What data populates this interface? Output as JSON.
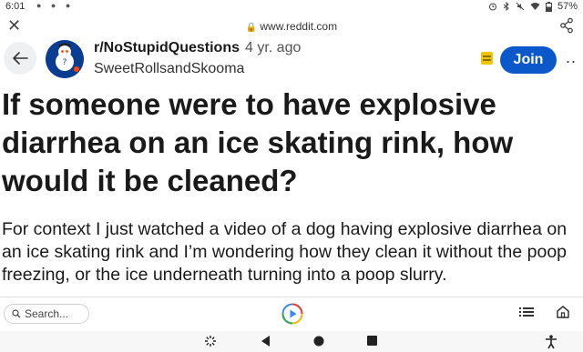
{
  "status": {
    "time": "6:01",
    "battery": "57%"
  },
  "browser": {
    "url": "www.reddit.com"
  },
  "post": {
    "subreddit": "r/NoStupidQuestions",
    "age": "4 yr. ago",
    "author": "SweetRollsandSkooma",
    "join_label": "Join",
    "more_label": "..",
    "title": "If someone were to have explosive diarrhea on an ice skating rink, how would it be cleaned?",
    "body": "For context I just watched a video of a dog having explosive diarrhea on an ice skating rink and I’m wondering how they clean it without the poop freezing, or the ice underneath turning into a poop slurry."
  },
  "toolbar": {
    "search_placeholder": "Search..."
  },
  "colors": {
    "join_button": "#0a58ca",
    "award_icon": "#f4c400",
    "avatar_bg": "#0a3d91"
  }
}
